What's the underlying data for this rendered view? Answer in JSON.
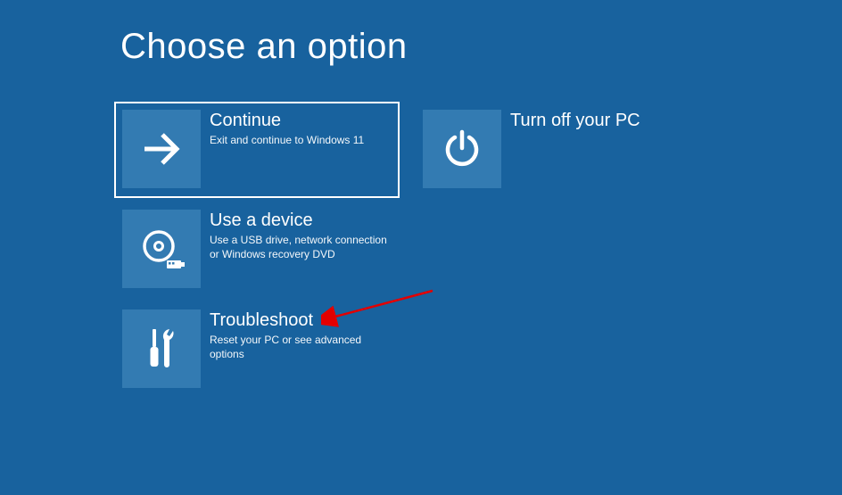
{
  "page": {
    "title": "Choose an option"
  },
  "options": {
    "continue": {
      "title": "Continue",
      "desc": "Exit and continue to Windows 11",
      "icon": "arrow-right-icon"
    },
    "turn_off": {
      "title": "Turn off your PC",
      "desc": "",
      "icon": "power-icon"
    },
    "use_device": {
      "title": "Use a device",
      "desc": "Use a USB drive, network connection or Windows recovery DVD",
      "icon": "disc-usb-icon"
    },
    "troubleshoot": {
      "title": "Troubleshoot",
      "desc": "Reset your PC or see advanced options",
      "icon": "tools-icon"
    }
  },
  "annotation": {
    "arrow_color": "#e30000"
  }
}
